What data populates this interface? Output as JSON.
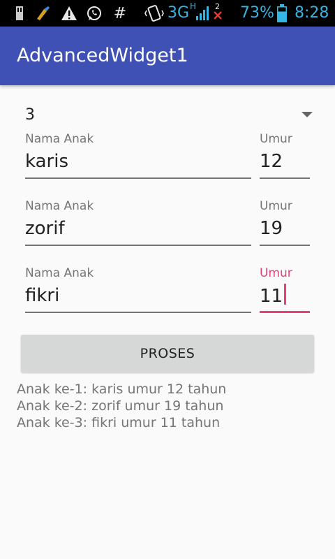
{
  "status_bar": {
    "network": "3G",
    "network_sub": "H",
    "sim_badge": "2",
    "battery": "73%",
    "time": "8:28",
    "hash": "#",
    "icons": [
      "usb-icon",
      "cleaner-icon",
      "warning-icon",
      "whatsapp-icon",
      "hash-icon",
      "vibrate-icon",
      "signal-icon",
      "no-signal-icon",
      "battery-icon"
    ]
  },
  "app_bar": {
    "title": "AdvancedWidget1"
  },
  "spinner": {
    "value": "3"
  },
  "children": [
    {
      "name_label": "Nama Anak",
      "name_value": "karis",
      "age_label": "Umur",
      "age_value": "12"
    },
    {
      "name_label": "Nama Anak",
      "name_value": "zorif",
      "age_label": "Umur",
      "age_value": "19"
    },
    {
      "name_label": "Nama Anak",
      "name_value": "fikri",
      "age_label": "Umur",
      "age_value": "11"
    }
  ],
  "button": {
    "label": "PROSES"
  },
  "result": [
    "Anak ke-1: karis umur 12 tahun",
    "Anak ke-2: zorif umur 19 tahun",
    "Anak ke-3: fikri umur 11 tahun"
  ],
  "colors": {
    "primary": "#3f51b5",
    "accent": "#e5407a",
    "status_icon": "#33b5e5"
  }
}
